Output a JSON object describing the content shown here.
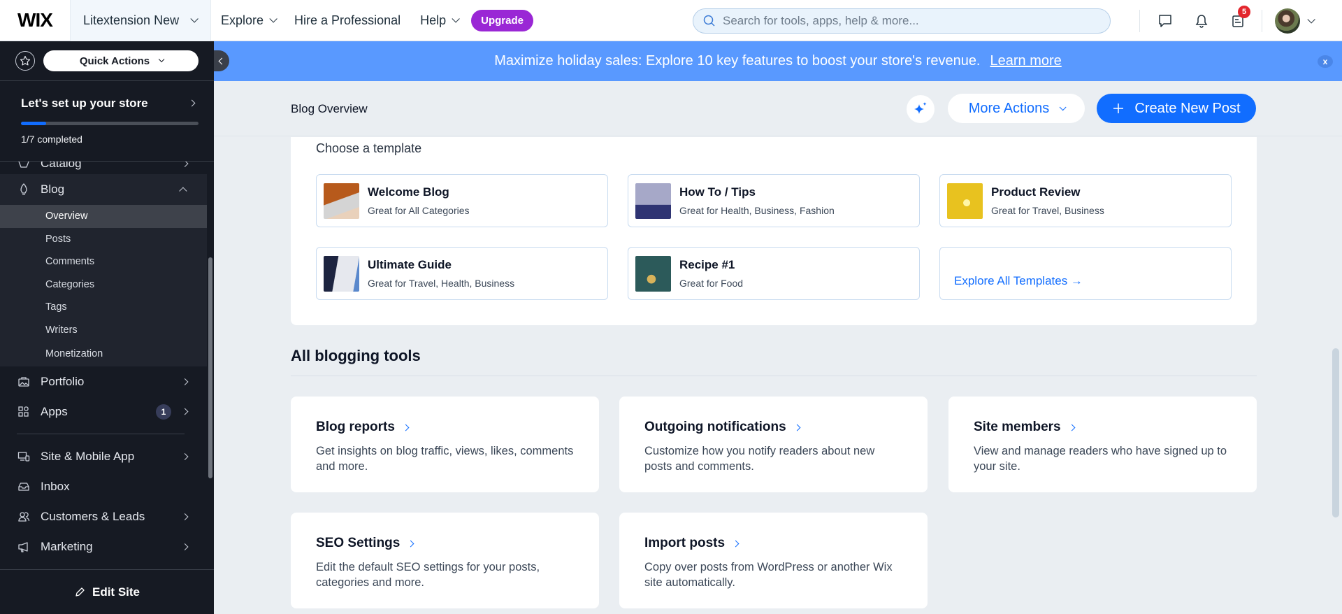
{
  "topbar": {
    "logo": "WIX",
    "site_name": "Litextension New",
    "nav": [
      {
        "label": "Explore",
        "has_dropdown": true
      },
      {
        "label": "Hire a Professional",
        "has_dropdown": false
      },
      {
        "label": "Help",
        "has_dropdown": true
      }
    ],
    "upgrade_label": "Upgrade",
    "search_placeholder": "Search for tools, apps, help & more...",
    "icons": [
      "chat-icon",
      "bell-icon",
      "updates-icon"
    ],
    "notifications_count": "5",
    "colors": {
      "upgrade": "#9a27d5",
      "badge": "#e3262d"
    }
  },
  "sidebar": {
    "quick_actions_label": "Quick Actions",
    "setup": {
      "title": "Let's set up your store",
      "progress": 0.14,
      "status": "1/7 completed"
    },
    "catalog_label": "Catalog",
    "blog": {
      "label": "Blog",
      "sub_items": [
        {
          "label": "Overview",
          "active": true
        },
        {
          "label": "Posts"
        },
        {
          "label": "Comments"
        },
        {
          "label": "Categories"
        },
        {
          "label": "Tags"
        },
        {
          "label": "Writers"
        },
        {
          "label": "Monetization"
        }
      ]
    },
    "items_a": [
      {
        "label": "Portfolio",
        "icon": "portfolio-icon"
      },
      {
        "label": "Apps",
        "icon": "apps-icon",
        "badge": "1"
      }
    ],
    "items_b": [
      {
        "label": "Site & Mobile App",
        "icon": "devices-icon",
        "chevron": true
      },
      {
        "label": "Inbox",
        "icon": "inbox-icon",
        "chevron": false
      },
      {
        "label": "Customers & Leads",
        "icon": "customers-icon",
        "chevron": true
      },
      {
        "label": "Marketing",
        "icon": "megaphone-icon",
        "chevron": true
      }
    ],
    "edit_site_label": "Edit Site"
  },
  "banner": {
    "text": "Maximize holiday sales: Explore 10 key features to boost your store's revenue.",
    "link": "Learn more",
    "close": "x",
    "color": "#5999ff"
  },
  "header": {
    "title": "Blog Overview",
    "more_actions": "More Actions",
    "create_post": "Create New Post",
    "accent": "#116dff"
  },
  "templates": {
    "heading": "Choose a template",
    "items": [
      {
        "name": "Welcome Blog",
        "desc": "Great for All Categories"
      },
      {
        "name": "How To / Tips",
        "desc": "Great for Health, Business, Fashion"
      },
      {
        "name": "Product Review",
        "desc": "Great for Travel, Business"
      },
      {
        "name": "Ultimate Guide",
        "desc": "Great for Travel, Health, Business"
      },
      {
        "name": "Recipe #1",
        "desc": "Great for Food"
      }
    ],
    "explore_all": "Explore All Templates →"
  },
  "tools": {
    "heading": "All blogging tools",
    "items": [
      {
        "title": "Blog reports",
        "desc": "Get insights on blog traffic, views, likes, comments and more."
      },
      {
        "title": "Outgoing notifications",
        "desc": "Customize how you notify readers about new posts and comments."
      },
      {
        "title": "Site members",
        "desc": "View and manage readers who have signed up to your site."
      },
      {
        "title": "SEO Settings",
        "desc": "Edit the default SEO settings for your posts, categories and more."
      },
      {
        "title": "Import posts",
        "desc": "Copy over posts from WordPress or another Wix site automatically."
      }
    ]
  }
}
